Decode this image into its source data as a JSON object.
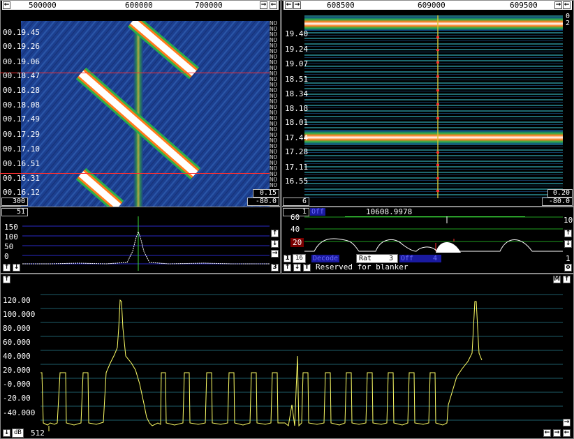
{
  "waterfall_left": {
    "freq_ticks": [
      "500000",
      "600000",
      "700000"
    ],
    "time_labels": [
      "00.19.45",
      "00.19.26",
      "00.19.06",
      "00.18.47",
      "00.18.28",
      "00.18.08",
      "00.17.49",
      "00.17.29",
      "00.17.10",
      "00.16.51",
      "00.16.31",
      "00.16.12"
    ],
    "no_marker": "NO",
    "gain": "0.15",
    "level": "-80.0",
    "avg": "300"
  },
  "waterfall_right": {
    "freq_ticks": [
      "608500",
      "609000",
      "609500"
    ],
    "time_labels": [
      "19.40",
      "19.24",
      "19.07",
      "18.51",
      "18.34",
      "18.18",
      "18.01",
      "17.44",
      "17.28",
      "17.11",
      "16.55"
    ],
    "top_right": [
      "0",
      "2"
    ],
    "gain": "0.20",
    "level": "-80.0",
    "avg": "6"
  },
  "spectrum_left": {
    "avg_box": "51",
    "y_ticks": [
      "150",
      "100",
      "50",
      "0"
    ],
    "corner": "3"
  },
  "hires_panel": {
    "index_box": "1",
    "mode_label": "Off",
    "frequency": "10608.9978",
    "y_ticks": [
      "60",
      "40",
      "20"
    ],
    "right_ticks": [
      "10",
      "1"
    ],
    "bottom_buttons": [
      "1",
      "16"
    ],
    "mode2": "Decode",
    "rat_label": "Rat",
    "rat_value": "3",
    "off_label": "Off",
    "off_value": "4",
    "status": "Reserved for blanker",
    "corner": "o"
  },
  "main_spectrum": {
    "y_ticks": [
      "120.00",
      "100.000",
      "80.000",
      "60.000",
      "40.000",
      "20.000",
      "-0.000",
      "-20.00",
      "-40.000"
    ],
    "db_label": "dB",
    "fft_size": "512",
    "m_button": "M"
  },
  "icons": {
    "left": "left-arrow-icon",
    "right": "right-arrow-icon",
    "up": "up-arrow-icon",
    "down": "down-arrow-icon"
  },
  "colors": {
    "grid_green": "#1fa01f",
    "trace_yellow": "#ffff66",
    "waterfall_bg": "#1c3f8f",
    "marker_red": "#ff2020"
  }
}
